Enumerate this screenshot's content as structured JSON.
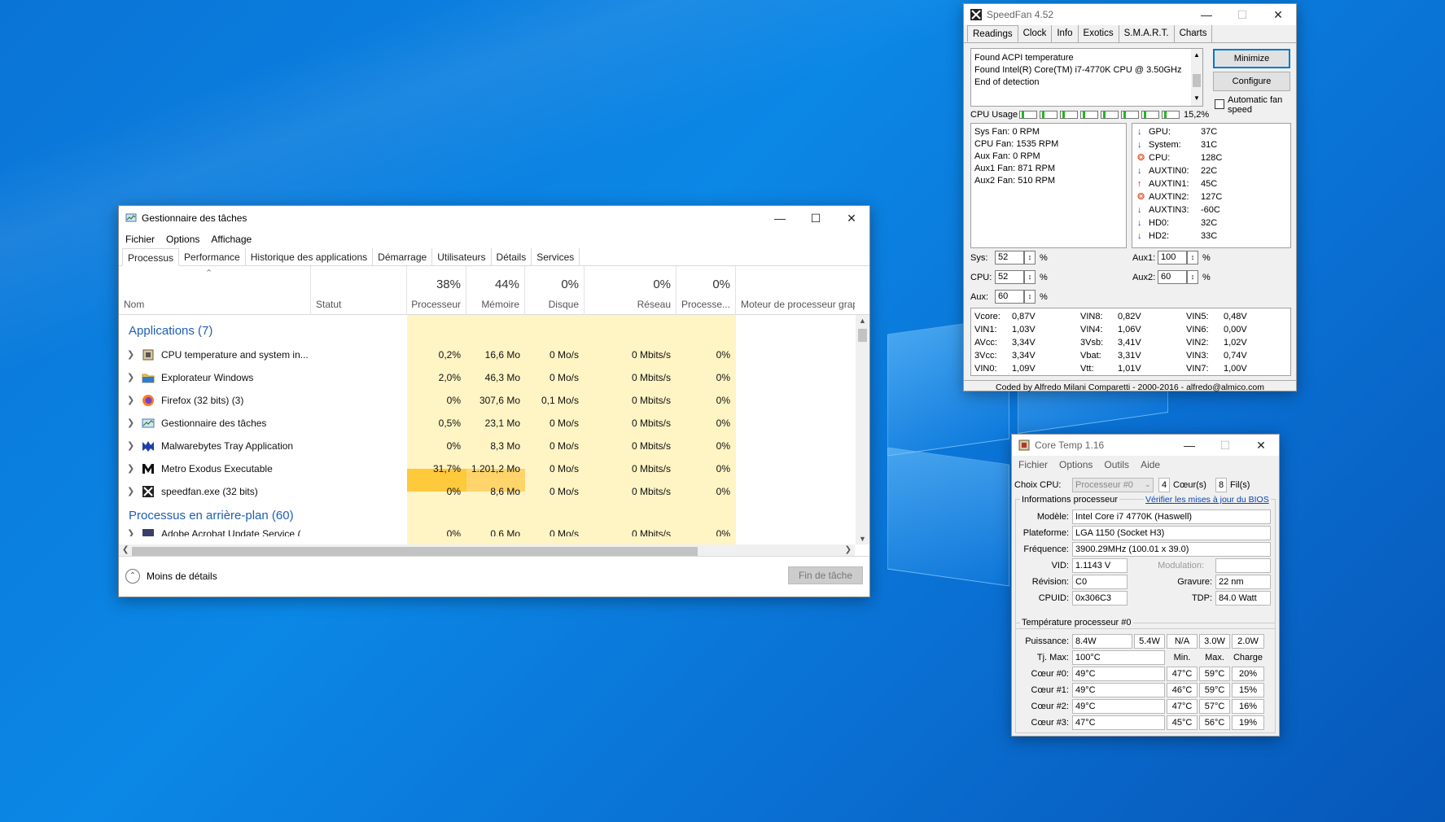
{
  "task_manager": {
    "title": "Gestionnaire des tâches",
    "menu": [
      "Fichier",
      "Options",
      "Affichage"
    ],
    "tabs": [
      "Processus",
      "Performance",
      "Historique des applications",
      "Démarrage",
      "Utilisateurs",
      "Détails",
      "Services"
    ],
    "columns": {
      "name": "Nom",
      "status": "Statut",
      "cpu_pct": "38%",
      "cpu": "Processeur",
      "mem_pct": "44%",
      "mem": "Mémoire",
      "disk_pct": "0%",
      "disk": "Disque",
      "net_pct": "0%",
      "net": "Réseau",
      "gpu_pct": "0%",
      "gpu": "Processe...",
      "gpu_engine": "Moteur de processeur graphic"
    },
    "group_apps": "Applications (7)",
    "group_bg": "Processus en arrière-plan (60)",
    "rows": [
      {
        "name": "CPU temperature and system in...",
        "cpu": "0,2%",
        "mem": "16,6 Mo",
        "disk": "0 Mo/s",
        "net": "0 Mbits/s",
        "gpu": "0%"
      },
      {
        "name": "Explorateur Windows",
        "cpu": "2,0%",
        "mem": "46,3 Mo",
        "disk": "0 Mo/s",
        "net": "0 Mbits/s",
        "gpu": "0%"
      },
      {
        "name": "Firefox (32 bits) (3)",
        "cpu": "0%",
        "mem": "307,6 Mo",
        "disk": "0,1 Mo/s",
        "net": "0 Mbits/s",
        "gpu": "0%"
      },
      {
        "name": "Gestionnaire des tâches",
        "cpu": "0,5%",
        "mem": "23,1 Mo",
        "disk": "0 Mo/s",
        "net": "0 Mbits/s",
        "gpu": "0%"
      },
      {
        "name": "Malwarebytes Tray Application",
        "cpu": "0%",
        "mem": "8,3 Mo",
        "disk": "0 Mo/s",
        "net": "0 Mbits/s",
        "gpu": "0%"
      },
      {
        "name": "Metro Exodus Executable",
        "cpu": "31,7%",
        "mem": "1.201,2 Mo",
        "disk": "0 Mo/s",
        "net": "0 Mbits/s",
        "gpu": "0%"
      },
      {
        "name": "speedfan.exe (32 bits)",
        "cpu": "0%",
        "mem": "8,6 Mo",
        "disk": "0 Mo/s",
        "net": "0 Mbits/s",
        "gpu": "0%"
      }
    ],
    "partial_row": {
      "name": "Adobe Acrobat Update Service (",
      "cpu": "0%",
      "mem": "0,6 Mo",
      "disk": "0 Mo/s",
      "net": "0 Mbits/s",
      "gpu": "0%"
    },
    "less_details": "Moins de détails",
    "end_task": "Fin de tâche"
  },
  "speedfan": {
    "title": "SpeedFan 4.52",
    "tabs": [
      "Readings",
      "Clock",
      "Info",
      "Exotics",
      "S.M.A.R.T.",
      "Charts"
    ],
    "log": [
      "Found ACPI temperature",
      "Found Intel(R) Core(TM) i7-4770K CPU @ 3.50GHz",
      "End of detection"
    ],
    "minimize": "Minimize",
    "configure": "Configure",
    "auto_fan": "Automatic fan speed",
    "cpu_usage_label": "CPU Usage",
    "cpu_usage": "15,2%",
    "fans": [
      [
        "Sys Fan:",
        "0 RPM"
      ],
      [
        "CPU Fan:",
        "1535 RPM"
      ],
      [
        "Aux Fan:",
        "0 RPM"
      ],
      [
        "Aux1 Fan:",
        "871 RPM"
      ],
      [
        "Aux2 Fan:",
        "510 RPM"
      ]
    ],
    "temps": [
      {
        "label": "GPU:",
        "value": "37C",
        "dir": "down"
      },
      {
        "label": "System:",
        "value": "31C",
        "dir": "down"
      },
      {
        "label": "CPU:",
        "value": "128C",
        "dir": "hot"
      },
      {
        "label": "AUXTIN0:",
        "value": "22C",
        "dir": "down"
      },
      {
        "label": "AUXTIN1:",
        "value": "45C",
        "dir": "up"
      },
      {
        "label": "AUXTIN2:",
        "value": "127C",
        "dir": "hot"
      },
      {
        "label": "AUXTIN3:",
        "value": "-60C",
        "dir": "down"
      },
      {
        "label": "HD0:",
        "value": "32C",
        "dir": "down"
      },
      {
        "label": "HD2:",
        "value": "33C",
        "dir": "down"
      }
    ],
    "speeds": {
      "sys_label": "Sys:",
      "sys": "52",
      "cpu_label": "CPU:",
      "cpu": "52",
      "aux_label": "Aux:",
      "aux": "60",
      "aux1_label": "Aux1:",
      "aux1": "100",
      "aux2_label": "Aux2:",
      "aux2": "60",
      "unit": "%"
    },
    "volts": [
      [
        "Vcore:",
        "0,87V"
      ],
      [
        "VIN8:",
        "0,82V"
      ],
      [
        "VIN5:",
        "0,48V"
      ],
      [
        "VIN1:",
        "1,03V"
      ],
      [
        "VIN4:",
        "1,06V"
      ],
      [
        "VIN6:",
        "0,00V"
      ],
      [
        "AVcc:",
        "3,34V"
      ],
      [
        "3Vsb:",
        "3,41V"
      ],
      [
        "VIN2:",
        "1,02V"
      ],
      [
        "3Vcc:",
        "3,34V"
      ],
      [
        "Vbat:",
        "3,31V"
      ],
      [
        "VIN3:",
        "0,74V"
      ],
      [
        "VIN0:",
        "1,09V"
      ],
      [
        "Vtt:",
        "1,01V"
      ],
      [
        "VIN7:",
        "1,00V"
      ]
    ],
    "footer": "Coded by Alfredo Milani Comparetti - 2000-2016 - alfredo@almico.com"
  },
  "coretemp": {
    "title": "Core Temp 1.16",
    "menu": [
      "Fichier",
      "Options",
      "Outils",
      "Aide"
    ],
    "cpu_choice_label": "Choix CPU:",
    "cpu_choice": "Processeur #0",
    "cores": "4",
    "cores_label": "Cœur(s)",
    "threads": "8",
    "threads_label": "Fil(s)",
    "info_label": "Informations processeur",
    "bios_link": "Vérifier les mises à jour du BIOS",
    "model_label": "Modèle:",
    "model": "Intel Core i7 4770K (Haswell)",
    "platform_label": "Plateforme:",
    "platform": "LGA 1150 (Socket H3)",
    "freq_label": "Fréquence:",
    "freq": "3900.29MHz (100.01 x 39.0)",
    "vid_label": "VID:",
    "vid": "1.1143 V",
    "modulation_label": "Modulation:",
    "revision_label": "Révision:",
    "revision": "C0",
    "litho_label": "Gravure:",
    "litho": "22 nm",
    "cpuid_label": "CPUID:",
    "cpuid": "0x306C3",
    "tdp_label": "TDP:",
    "tdp": "84.0 Watt",
    "temp_label": "Température processeur #0",
    "power_label": "Puissance:",
    "power": [
      "8.4W",
      "5.4W",
      "N/A",
      "3.0W",
      "2.0W"
    ],
    "tjmax_label": "Tj. Max:",
    "tjmax": "100°C",
    "min_label": "Min.",
    "max_label": "Max.",
    "load_label": "Charge",
    "cores_rows": [
      {
        "label": "Cœur #0:",
        "temp": "49°C",
        "min": "47°C",
        "max": "59°C",
        "load": "20%"
      },
      {
        "label": "Cœur #1:",
        "temp": "49°C",
        "min": "46°C",
        "max": "59°C",
        "load": "15%"
      },
      {
        "label": "Cœur #2:",
        "temp": "49°C",
        "min": "47°C",
        "max": "57°C",
        "load": "16%"
      },
      {
        "label": "Cœur #3:",
        "temp": "47°C",
        "min": "45°C",
        "max": "56°C",
        "load": "19%"
      }
    ]
  }
}
